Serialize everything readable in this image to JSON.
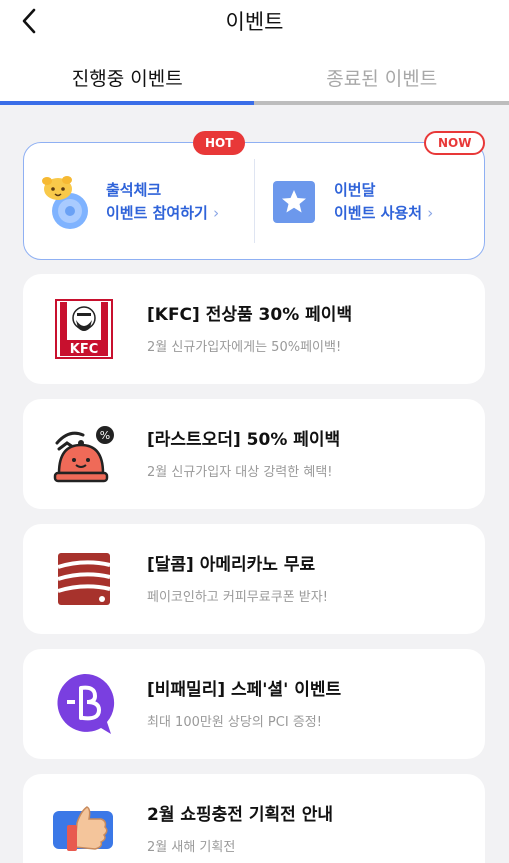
{
  "header": {
    "title": "이벤트",
    "back_icon": "chevron-left-icon"
  },
  "tabs": [
    {
      "label": "진행중 이벤트",
      "active": true
    },
    {
      "label": "종료된 이벤트",
      "active": false
    }
  ],
  "colors": {
    "accent": "#3a6ee8",
    "hot": "#e83838",
    "promo_text": "#2f63d9"
  },
  "promo": {
    "left": {
      "badge": "HOT",
      "line1": "출석체크",
      "line2": "이벤트 참여하기",
      "chevron": "›",
      "icon": "mascot-coin-icon"
    },
    "right": {
      "badge": "NOW",
      "line1": "이번달",
      "line2": "이벤트 사용처",
      "chevron": "›",
      "icon": "star-icon"
    }
  },
  "events": [
    {
      "title": "[KFC] 전상품 30% 페이백",
      "subtitle": "2월 신규가입자에게는 50%페이백!",
      "icon": "kfc-logo-icon"
    },
    {
      "title": "[라스트오더] 50% 페이백",
      "subtitle": "2월 신규가입자 대상 강력한 혜택!",
      "icon": "last-order-bell-icon"
    },
    {
      "title": "[달콤] 아메리카노 무료",
      "subtitle": "페이코인하고 커피무료쿠폰 받자!",
      "icon": "dalkomm-logo-icon"
    },
    {
      "title": "[비패밀리] 스페'셜' 이벤트",
      "subtitle": "최대 100만원 상당의 PCI 증정!",
      "icon": "bfamily-logo-icon"
    },
    {
      "title": "2월 쇼핑충전 기획전 안내",
      "subtitle": "2월 새해 기획전",
      "icon": "thumbs-up-icon"
    }
  ]
}
